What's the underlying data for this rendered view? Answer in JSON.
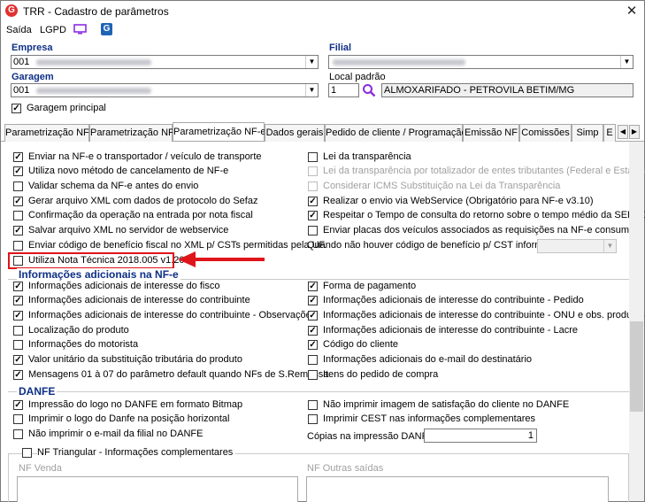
{
  "window": {
    "title": "TRR - Cadastro de parâmetros",
    "close": "✕"
  },
  "menubar": {
    "saida": "Saída",
    "lgpd": "LGPD"
  },
  "empresa": {
    "label": "Empresa",
    "code": "001"
  },
  "filial": {
    "label": "Filial"
  },
  "garagem": {
    "label": "Garagem",
    "code": "001",
    "principal_label": "Garagem principal",
    "principal_checked": true
  },
  "local_padrao": {
    "label": "Local padrão",
    "code": "1",
    "descricao": "ALMOXARIFADO - PETROVILA BETIM/MG"
  },
  "tabs": [
    "Parametrização NF",
    "Parametrização NF",
    "Parametrização NF-e",
    "Dados gerais",
    "Pedido de cliente / Programação",
    "Emissão NF",
    "Comissões",
    "Simp",
    "E"
  ],
  "options_left": [
    {
      "label": "Enviar na NF-e o transportador / veículo de transporte",
      "checked": true
    },
    {
      "label": "Utiliza novo método de cancelamento de NF-e",
      "checked": true
    },
    {
      "label": "Validar schema da NF-e antes do envio",
      "checked": false
    },
    {
      "label": "Gerar arquivo XML com dados de protocolo do Sefaz",
      "checked": true
    },
    {
      "label": "Confirmação da operação na entrada por nota fiscal",
      "checked": false
    },
    {
      "label": "Salvar arquivo XML no servidor de webservice",
      "checked": true
    },
    {
      "label": "Enviar código de benefício fiscal no XML p/ CSTs permitidas pela UF.",
      "checked": false
    },
    {
      "label": "Utiliza Nota Técnica 2018.005 v1.20",
      "checked": false
    }
  ],
  "options_right": [
    {
      "label": "Lei da transparência",
      "checked": false,
      "disabled": false
    },
    {
      "label": "Lei da transparência por totalizador de entes tributantes (Federal e Estadual)",
      "checked": false,
      "disabled": true
    },
    {
      "label": "Considerar ICMS Substituição na Lei da Transparência",
      "checked": false,
      "disabled": true
    },
    {
      "label": "Realizar o envio via WebService (Obrigatório para NF-e v3.10)",
      "checked": true,
      "disabled": false
    },
    {
      "label": "Respeitar o Tempo de consulta do retorno sobre o tempo médio da SEFAZ",
      "checked": true,
      "disabled": false
    },
    {
      "label": "Enviar placas dos veículos associados as requisições na NF-e consumo",
      "checked": false,
      "disabled": false
    }
  ],
  "cst_label": "Quando não houver código de benefício p/ CST informar",
  "info_section": {
    "title": "Informações adicionais na NF-e",
    "left": [
      {
        "label": "Informações adicionais de interesse do fisco",
        "checked": true
      },
      {
        "label": "Informações adicionais de interesse do contribuinte",
        "checked": true
      },
      {
        "label": "Informações adicionais de interesse do contribuinte - Observações",
        "checked": true
      },
      {
        "label": "Localização do produto",
        "checked": false
      },
      {
        "label": "Informações do motorista",
        "checked": false
      },
      {
        "label": "Valor unitário da substituição tributária do produto",
        "checked": true
      },
      {
        "label": "Mensagens 01 à 07 do parâmetro default quando NFs de S.Remessa",
        "checked": true
      }
    ],
    "right": [
      {
        "label": "Forma de pagamento",
        "checked": true
      },
      {
        "label": "Informações adicionais de interesse do contribuinte - Pedido",
        "checked": true
      },
      {
        "label": "Informações adicionais de interesse do contribuinte - ONU e obs. produtos",
        "checked": true
      },
      {
        "label": "Informações adicionais de interesse do contribuinte - Lacre",
        "checked": true
      },
      {
        "label": "Código do cliente",
        "checked": true
      },
      {
        "label": "Informações adicionais do e-mail do destinatário",
        "checked": false
      },
      {
        "label": "Itens do pedido de compra",
        "checked": false
      }
    ]
  },
  "danfe_section": {
    "title": "DANFE",
    "left": [
      {
        "label": "Impressão do logo no DANFE em formato Bitmap",
        "checked": true
      },
      {
        "label": "Imprimir o logo do Danfe na posição horizontal",
        "checked": false
      },
      {
        "label": "Não imprimir o e-mail da filial no DANFE",
        "checked": false
      }
    ],
    "right": [
      {
        "label": "Não imprimir imagem de satisfação do cliente no DANFE",
        "checked": false
      },
      {
        "label": "Imprimir CEST nas informações complementares",
        "checked": false
      }
    ],
    "copias_label": "Cópias na impressão DANFE",
    "copias_value": "1"
  },
  "triangular": {
    "label": "NF Triangular - Informações complementares",
    "checked": false,
    "nf_venda": "NF Venda",
    "nf_outras": "NF Outras saídas"
  },
  "check_mark": "✓"
}
